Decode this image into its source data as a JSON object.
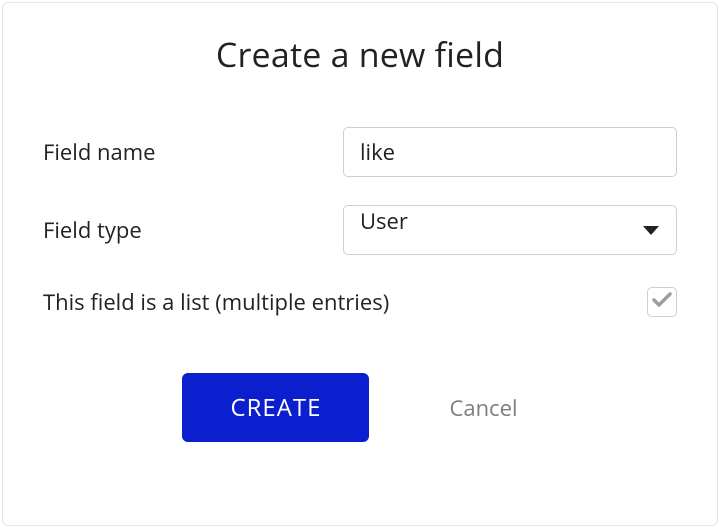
{
  "dialog": {
    "title": "Create a new field"
  },
  "form": {
    "field_name_label": "Field name",
    "field_name_value": "like",
    "field_type_label": "Field type",
    "field_type_value": "User",
    "list_checkbox_label": "This field is a list (multiple entries)",
    "list_checked": true
  },
  "actions": {
    "create_label": "CREATE",
    "cancel_label": "Cancel"
  },
  "colors": {
    "primary": "#0b1fce",
    "text": "#222222",
    "muted": "#7d7d7d",
    "border": "#d0d0d0"
  }
}
